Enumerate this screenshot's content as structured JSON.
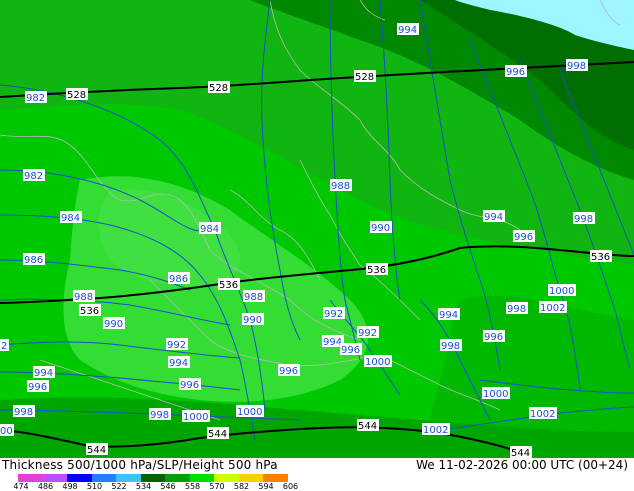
{
  "title": "Thickness 500/1000 hPa/SLP/Height 500 hPa",
  "valid_time": "We 11-02-2026 00:00 UTC (00+24)",
  "legend": {
    "ticks": [
      "474",
      "486",
      "498",
      "510",
      "522",
      "534",
      "546",
      "558",
      "570",
      "582",
      "594",
      "606"
    ],
    "colors": [
      "#e040e0",
      "#c050ff",
      "#0000ff",
      "#2080ff",
      "#40c0ff",
      "#006400",
      "#00a000",
      "#00e000",
      "#d0ff00",
      "#ffd000",
      "#ff8000"
    ]
  },
  "colors": {
    "sea": "#9ff5ff",
    "thickness_528": "#008800",
    "thickness_534": "#00b000",
    "thickness_540": "#22cc22",
    "thickness_546": "#44e044",
    "isobar": "#1a4fd0",
    "height_line": "#000000"
  },
  "height_labels": [
    {
      "id": "h528a",
      "text": "528"
    },
    {
      "id": "h528b",
      "text": "528"
    },
    {
      "id": "h528c",
      "text": "528"
    },
    {
      "id": "h536a",
      "text": "536"
    },
    {
      "id": "h536b",
      "text": "536"
    },
    {
      "id": "h536c",
      "text": "536"
    },
    {
      "id": "h536d",
      "text": "536"
    },
    {
      "id": "h544a",
      "text": "544"
    },
    {
      "id": "h544b",
      "text": "544"
    },
    {
      "id": "h544c",
      "text": "544"
    },
    {
      "id": "h544d",
      "text": "544"
    }
  ],
  "isobar_labels": [
    {
      "id": "p994a",
      "text": "994"
    },
    {
      "id": "p996a",
      "text": "996"
    },
    {
      "id": "p998a",
      "text": "998"
    },
    {
      "id": "p982a",
      "text": "982"
    },
    {
      "id": "p982b",
      "text": "982"
    },
    {
      "id": "p988a",
      "text": "988"
    },
    {
      "id": "p984a",
      "text": "984"
    },
    {
      "id": "p984b",
      "text": "984"
    },
    {
      "id": "p990a",
      "text": "990"
    },
    {
      "id": "p994b",
      "text": "994"
    },
    {
      "id": "p998b",
      "text": "998"
    },
    {
      "id": "p996b",
      "text": "996"
    },
    {
      "id": "p986a",
      "text": "986"
    },
    {
      "id": "p986b",
      "text": "986"
    },
    {
      "id": "p988b",
      "text": "988"
    },
    {
      "id": "p988c",
      "text": "988"
    },
    {
      "id": "p990b",
      "text": "990"
    },
    {
      "id": "p990c",
      "text": "990"
    },
    {
      "id": "p1000a",
      "text": "1000"
    },
    {
      "id": "p1002a",
      "text": "1002"
    },
    {
      "id": "p998c",
      "text": "998"
    },
    {
      "id": "p992a",
      "text": "992"
    },
    {
      "id": "p994c",
      "text": "994"
    },
    {
      "id": "p992b",
      "text": "992"
    },
    {
      "id": "p994d",
      "text": "994"
    },
    {
      "id": "p996c",
      "text": "996"
    },
    {
      "id": "p998d",
      "text": "998"
    },
    {
      "id": "p996d",
      "text": "996"
    },
    {
      "id": "p992c",
      "text": "992"
    },
    {
      "id": "p1000b",
      "text": "1000"
    },
    {
      "id": "p994e",
      "text": "994"
    },
    {
      "id": "p996e",
      "text": "996"
    },
    {
      "id": "p996f",
      "text": "996"
    },
    {
      "id": "p998e",
      "text": "998"
    },
    {
      "id": "p998f",
      "text": "998"
    },
    {
      "id": "p1000c",
      "text": "1000"
    },
    {
      "id": "p1000d",
      "text": "1000"
    },
    {
      "id": "p1000e",
      "text": "1000"
    },
    {
      "id": "p1002b",
      "text": "1002"
    },
    {
      "id": "p1002c",
      "text": "1002"
    },
    {
      "id": "p2",
      "text": "2"
    },
    {
      "id": "p00",
      "text": "00"
    }
  ]
}
